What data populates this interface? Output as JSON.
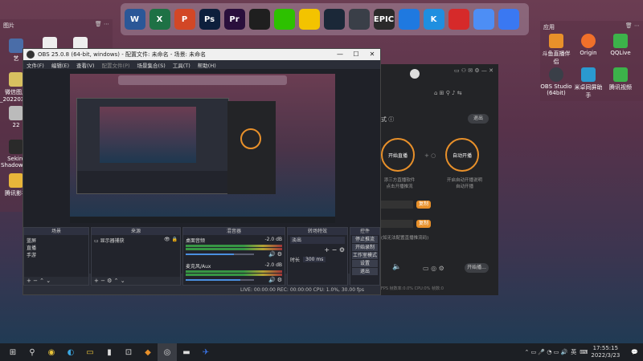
{
  "dock": {
    "icons": [
      {
        "name": "word-icon",
        "label": "W",
        "color": "#2b5797"
      },
      {
        "name": "excel-icon",
        "label": "X",
        "color": "#1e7145"
      },
      {
        "name": "powerpoint-icon",
        "label": "P",
        "color": "#d24726"
      },
      {
        "name": "photoshop-icon",
        "label": "Ps",
        "color": "#0d1f3c"
      },
      {
        "name": "premiere-icon",
        "label": "Pr",
        "color": "#2a0f3c"
      },
      {
        "name": "qq-icon",
        "label": "",
        "color": "#1f1f1f"
      },
      {
        "name": "wechat-icon",
        "label": "",
        "color": "#2dc100"
      },
      {
        "name": "game-icon",
        "label": "",
        "color": "#f3c300"
      },
      {
        "name": "steam-icon",
        "label": "",
        "color": "#1b2838"
      },
      {
        "name": "obs-icon",
        "label": "",
        "color": "#3a3f48"
      },
      {
        "name": "epic-icon",
        "label": "EPIC",
        "color": "#2a2a2a"
      },
      {
        "name": "tencent-meeting-icon",
        "label": "",
        "color": "#1f79e0"
      },
      {
        "name": "kugou-icon",
        "label": "K",
        "color": "#1f8fe0"
      },
      {
        "name": "netease-music-icon",
        "label": "",
        "color": "#d62a2a"
      },
      {
        "name": "baidu-icon",
        "label": "",
        "color": "#4d8ef5"
      },
      {
        "name": "feishu-icon",
        "label": "",
        "color": "#3a78f2"
      }
    ]
  },
  "left_panel": {
    "title": "图片",
    "items": [
      {
        "label": "艺",
        "color": "#4a6da8"
      },
      {
        "label": "微信图片_2022031...",
        "color": "#d8c060"
      },
      {
        "label": "22",
        "color": "#bbbbbb"
      },
      {
        "label": "Sekiro Shadows...",
        "color": "#2a2a2a"
      },
      {
        "label": "腾讯影视",
        "color": "#e8b53a"
      }
    ]
  },
  "right_panel": {
    "title": "应用",
    "items": [
      {
        "label": "斗鱼直播伴侣",
        "color": "#e8902a"
      },
      {
        "label": "Origin",
        "color": "#f0702a"
      },
      {
        "label": "QQLive",
        "color": "#3cb34a"
      },
      {
        "label": "OBS Studio (64bit)",
        "color": "#3a3f48"
      },
      {
        "label": "米卓同屏助手",
        "color": "#2a9ad0"
      },
      {
        "label": "腾讯视频",
        "color": "#3cb34a"
      }
    ]
  },
  "bg_app": {
    "exit_label": "退出",
    "ring1_label": "开始直播",
    "ring2_label": "自动开播",
    "ring1_caption": "添三方直播软件\n点击开播推流",
    "ring2_caption": "开启自动开播说明\n自动开播",
    "copy_label": "复制",
    "hint": "(如无法配置直播推流码)",
    "start_label": "开始播...",
    "stats": "FPS    帧数率:0.0%    CPU:0%    帧数:0"
  },
  "obs": {
    "title": "OBS 25.0.8 (64-bit, windows) - 配置文件: 未命名 - 场景: 未命名",
    "menu": [
      "文件(F)",
      "编辑(E)",
      "查看(V)",
      "配置文件(P)",
      "场景集合(S)",
      "工具(T)",
      "帮助(H)"
    ],
    "scenes": {
      "title": "场景",
      "items": [
        "蓝屏",
        "直播",
        "手游"
      ]
    },
    "sources": {
      "title": "来源",
      "items": [
        "显示器捕获"
      ]
    },
    "mixer": {
      "title": "混音器",
      "channels": [
        {
          "name": "桌面音频",
          "db": "-2.0 dB",
          "level": 0.7
        },
        {
          "name": "麦克风/Aux",
          "db": "-2.0 dB",
          "level": 0.8
        }
      ]
    },
    "transitions": {
      "title": "转场特效",
      "type": "淡出",
      "duration_label": "时长",
      "duration_value": "300 ms"
    },
    "controls": {
      "title": "控件",
      "buttons": [
        "停止推流",
        "开始录制",
        "工作室模式",
        "设置",
        "退出"
      ]
    },
    "status": "LIVE: 00:00:00    REC: 00:00:00    CPU: 1.0%, 30.00 fps"
  },
  "taskbar": {
    "lang": "英",
    "time": "17:55:15",
    "date": "2022/3/23"
  }
}
